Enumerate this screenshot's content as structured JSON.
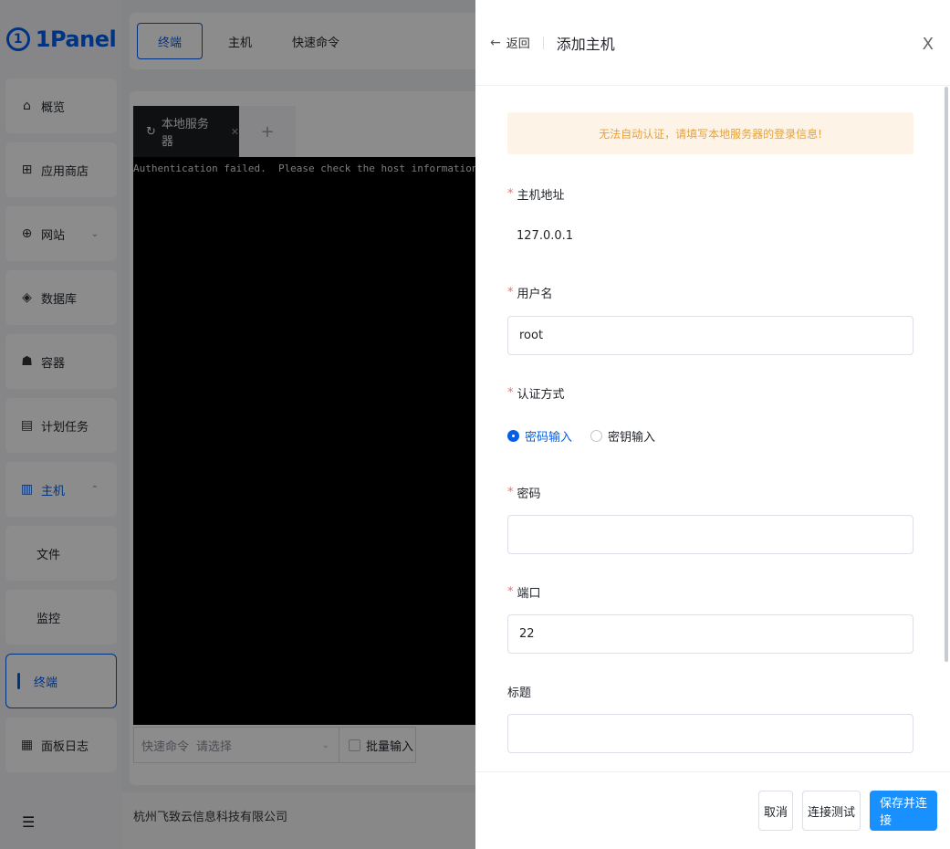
{
  "sidebar": {
    "logo": "1Panel",
    "items": [
      {
        "label": "概览",
        "icon": "home-icon"
      },
      {
        "label": "应用商店",
        "icon": "apps-grid-icon"
      },
      {
        "label": "网站",
        "icon": "globe-icon"
      },
      {
        "label": "数据库",
        "icon": "layers-icon"
      },
      {
        "label": "容器",
        "icon": "docker-whale-icon"
      },
      {
        "label": "计划任务",
        "icon": "calendar-icon"
      },
      {
        "label": "主机",
        "icon": "server-icon"
      },
      {
        "label": "文件"
      },
      {
        "label": "监控"
      },
      {
        "label": "终端"
      },
      {
        "label": "面板日志",
        "icon": "log-icon"
      }
    ]
  },
  "topbar": {
    "tabs": [
      "终端",
      "主机",
      "快速命令"
    ]
  },
  "terminal": {
    "tab_label": "本地服务器",
    "output": "Authentication failed.  Please check the host information !",
    "quick_command_label": "快速命令",
    "quick_command_placeholder": "请选择",
    "batch_input_label": "批量输入"
  },
  "footer": {
    "company": "杭州飞致云信息科技有限公司"
  },
  "drawer": {
    "back_label": "返回",
    "title": "添加主机",
    "alert": "无法自动认证，请填写本地服务器的登录信息!",
    "fields": {
      "host": {
        "label": "主机地址",
        "value": "127.0.0.1"
      },
      "username": {
        "label": "用户名",
        "value": "root"
      },
      "auth_method": {
        "label": "认证方式",
        "options": [
          "密码输入",
          "密钥输入"
        ],
        "selected": "密码输入"
      },
      "password": {
        "label": "密码",
        "value": ""
      },
      "port": {
        "label": "端口",
        "value": "22"
      },
      "title": {
        "label": "标题",
        "value": ""
      }
    },
    "buttons": {
      "cancel": "取消",
      "test": "连接测试",
      "save": "保存并连接"
    }
  },
  "colors": {
    "primary": "#005eeb",
    "button_primary": "#1890ff",
    "alert_bg": "#fdf3e6",
    "alert_text": "#e6a23c",
    "required": "#f56c6c"
  }
}
